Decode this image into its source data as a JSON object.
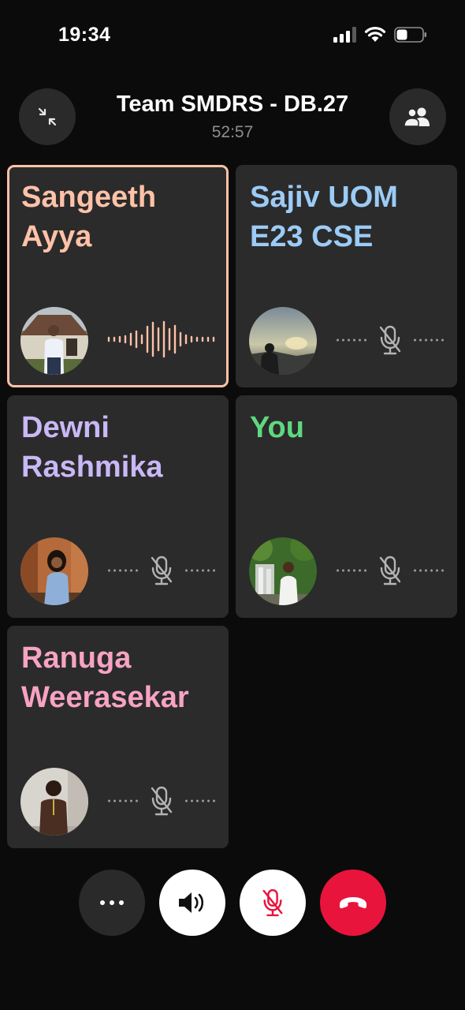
{
  "status_bar": {
    "time": "19:34",
    "signal_icon": "cellular-signal-icon",
    "wifi_icon": "wifi-icon",
    "battery_icon": "battery-icon"
  },
  "header": {
    "title": "Team SMDRS - DB.27",
    "duration": "52:57",
    "minimize_icon": "minimize-icon",
    "participants_icon": "participants-icon"
  },
  "participants": [
    {
      "name": "Sangeeth Ayya",
      "name_color": "#ffc2a8",
      "speaking": true,
      "muted": false
    },
    {
      "name": "Sajiv UOM E23 CSE",
      "name_color": "#9ccbf6",
      "speaking": false,
      "muted": true
    },
    {
      "name": "Dewni Rashmika",
      "name_color": "#c9b8f6",
      "speaking": false,
      "muted": true
    },
    {
      "name": "You",
      "name_color": "#5fd880",
      "speaking": false,
      "muted": true
    },
    {
      "name": "Ranuga Weerasekar",
      "name_color": "#f7a3c3",
      "speaking": false,
      "muted": true
    }
  ],
  "controls": {
    "more_icon": "more-icon",
    "speaker_icon": "speaker-icon",
    "mic_icon": "mic-off-icon",
    "end_icon": "end-call-icon",
    "end_color": "#e8143c",
    "mic_icon_color": "#e8143c"
  }
}
